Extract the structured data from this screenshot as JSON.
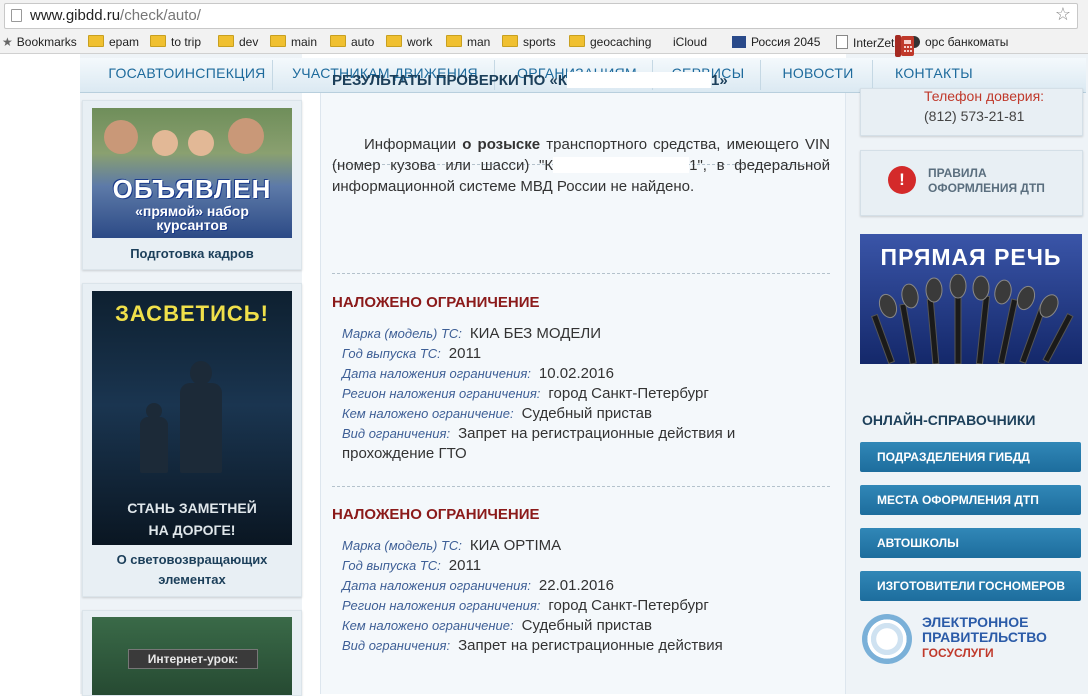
{
  "browser": {
    "url_host": "www.gibdd.ru",
    "url_path": "/check/auto/",
    "bookmarks": [
      "Bookmarks",
      "epam",
      "to trip",
      "dev",
      "main",
      "auto",
      "work",
      "man",
      "sports",
      "geocaching",
      "iCloud",
      "Россия 2045",
      "InterZet",
      "орс банкоматы"
    ]
  },
  "nav": {
    "items": [
      "ГОСАВТОИНСПЕКЦИЯ",
      "УЧАСТНИКАМ ДВИЖЕНИЯ",
      "ОРГАНИЗАЦИЯМ",
      "СЕРВИСЫ",
      "НОВОСТИ",
      "КОНТАКТЫ"
    ]
  },
  "left": {
    "banner1": {
      "headline": "ОБЪЯВЛЕН",
      "sub1": "«прямой» набор",
      "sub2": "курсантов",
      "caption": "Подготовка кадров"
    },
    "banner2": {
      "headline": "ЗАСВЕТИСЬ!",
      "sub": "СТАНЬ ЗАМЕТНЕЙ НА ДОРОГЕ!",
      "caption": "О световозвращающих элементах"
    },
    "banner3": {
      "headline": "Интернет-урок:"
    }
  },
  "content": {
    "title_prefix": "РЕЗУЛЬТАТЫ ПРОВЕРКИ ПО «К",
    "title_suffix": "1»",
    "info_p1": "Информации",
    "info_bold": "о розыске",
    "info_p2": "транспортного средства, имеющего VIN (номер кузова или шасси) \"К",
    "info_p3": "1\", в федеральной информационной системе МВД России не найдено.",
    "restrictions": [
      {
        "title": "НАЛОЖЕНО ОГРАНИЧЕНИЕ",
        "make_label": "Марка (модель) ТС:",
        "make": "КИА БЕЗ МОДЕЛИ",
        "year_label": "Год выпуска ТС:",
        "year": "2011",
        "date_label": "Дата наложения ограничения:",
        "date": "10.02.2016",
        "region_label": "Регион наложения ограничения:",
        "region": "город Санкт-Петербург",
        "by_label": "Кем наложено ограничение:",
        "by": "Судебный пристав",
        "type_label": "Вид ограничения:",
        "type": "Запрет на регистрационные действия и прохождение ГТО"
      },
      {
        "title": "НАЛОЖЕНО ОГРАНИЧЕНИЕ",
        "make_label": "Марка (модель) ТС:",
        "make": "КИА OPTIMA",
        "year_label": "Год выпуска ТС:",
        "year": "2011",
        "date_label": "Дата наложения ограничения:",
        "date": "22.01.2016",
        "region_label": "Регион наложения ограничения:",
        "region": "город Санкт-Петербург",
        "by_label": "Кем наложено ограничение:",
        "by": "Судебный пристав",
        "type_label": "Вид ограничения:",
        "type": "Запрет на регистрационные действия"
      }
    ]
  },
  "right": {
    "hotline_label": "Телефон доверия:",
    "hotline_number": "(812) 573-21-81",
    "rules_line1": "ПРАВИЛА",
    "rules_line2": "ОФОРМЛЕНИЯ ДТП",
    "speech_title": "ПРЯМАЯ РЕЧЬ",
    "online_title": "ОНЛАЙН-СПРАВОЧНИКИ",
    "buttons": [
      "ПОДРАЗДЕЛЕНИЯ ГИБДД",
      "МЕСТА ОФОРМЛЕНИЯ ДТП",
      "АВТОШКОЛЫ",
      "ИЗГОТОВИТЕЛИ ГОСНОМЕРОВ"
    ],
    "egov_line1": "ЭЛЕКТРОННОЕ",
    "egov_line2": "ПРАВИТЕЛЬСТВО",
    "egov_line3": "ГОСУСЛУГИ"
  }
}
